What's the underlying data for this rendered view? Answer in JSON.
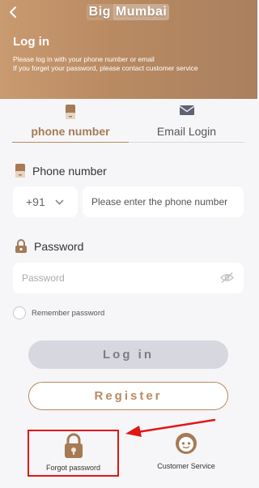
{
  "header": {
    "logo_part1": "Big",
    "logo_part2": "Mumbai",
    "title": "Log in",
    "subtitle_line1": "Please log in with your phone number or email",
    "subtitle_line2": "If you forget your password, please contact customer service"
  },
  "tabs": [
    {
      "label": "phone number",
      "icon": "phone-icon",
      "active": true
    },
    {
      "label": "Email Login",
      "icon": "mail-icon",
      "active": false
    }
  ],
  "phone": {
    "label": "Phone number",
    "country_code": "+91",
    "placeholder": "Please enter the phone number"
  },
  "password": {
    "label": "Password",
    "placeholder": "Password"
  },
  "remember_label": "Remember password",
  "buttons": {
    "login": "Log in",
    "register": "Register"
  },
  "shortcuts": {
    "forgot": "Forgot password",
    "service": "Customer Service"
  },
  "colors": {
    "accent": "#b98a62",
    "highlight": "#e01717"
  }
}
